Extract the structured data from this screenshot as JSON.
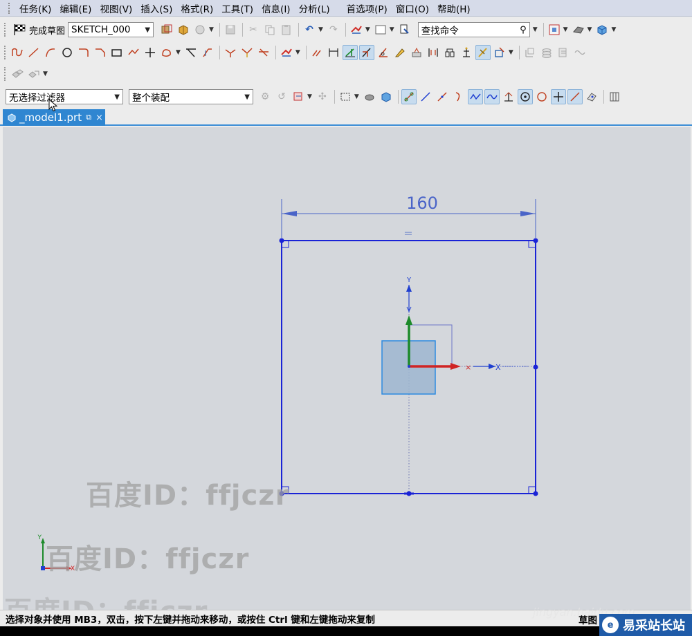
{
  "menu": {
    "items": [
      "任务(K)",
      "编辑(E)",
      "视图(V)",
      "插入(S)",
      "格式(R)",
      "工具(T)",
      "信息(I)",
      "分析(L)",
      "首选项(P)",
      "窗口(O)",
      "帮助(H)"
    ]
  },
  "sketch_toolbar": {
    "finish_sketch_label": "完成草图",
    "sketch_name": "SKETCH_000",
    "command_search_placeholder": "查找命令"
  },
  "selection_bar": {
    "filter_value": "无选择过滤器",
    "scope_value": "整个装配"
  },
  "tab": {
    "label": "_model1.prt"
  },
  "sketch": {
    "dimension_value": "160",
    "equal_constraint_symbol": "=",
    "y_axis_label": "Y",
    "x_axis_label": "X",
    "triad_y_label": "Y",
    "triad_x_label": "X"
  },
  "watermarks": [
    "百度ID：ffjczr",
    "百度ID：ffjczr",
    "百度ID：ffjczr"
  ],
  "status": {
    "message": "选择对象并使用 MB3，双击，按下左键并拖动来移动，或按住 Ctrl 键和左键拖动来复制",
    "mode": "草图"
  },
  "branding": {
    "site_watermark": "jingyan.baidu.com",
    "logo_text": "易采站长站",
    "logo_mark": "e"
  },
  "colors": {
    "sketch_line": "#1a23d6",
    "dimension": "#4a64c8",
    "csys_x": "#d02424",
    "csys_y": "#1c8a2a",
    "csys_z": "#1f3fd0",
    "tab_active": "#2f86d1",
    "canvas_bg": "#d4d7dc"
  }
}
